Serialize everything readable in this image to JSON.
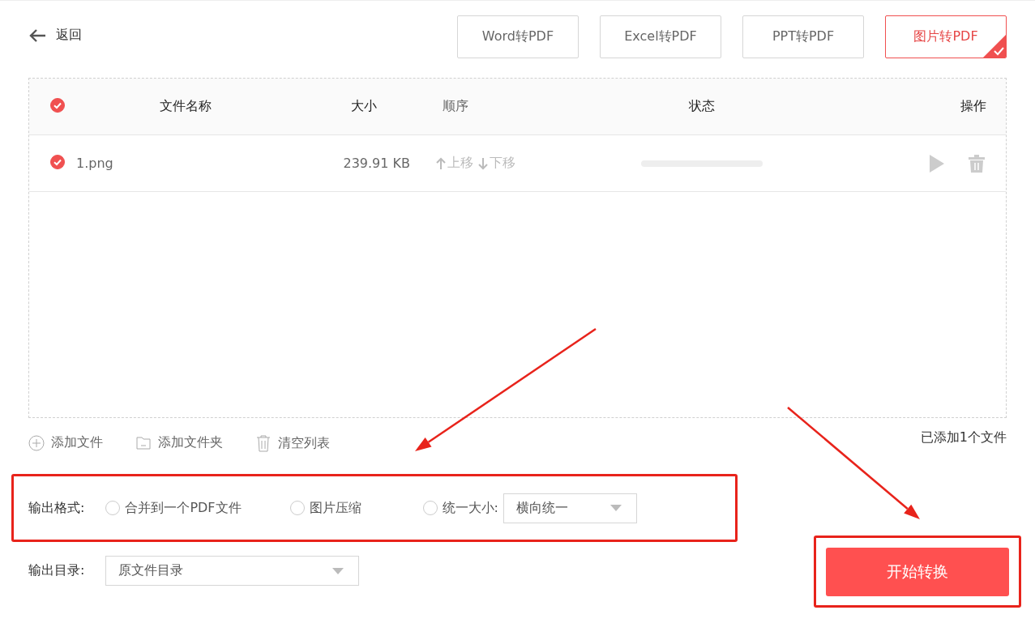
{
  "back": {
    "label": "返回"
  },
  "tabs": [
    {
      "label": "Word转PDF",
      "selected": false
    },
    {
      "label": "Excel转PDF",
      "selected": false
    },
    {
      "label": "PPT转PDF",
      "selected": false
    },
    {
      "label": "图片转PDF",
      "selected": true
    }
  ],
  "table": {
    "header_checked": true,
    "columns": [
      "文件名称",
      "大小",
      "顺序",
      "状态",
      "操作"
    ],
    "rows": [
      {
        "checked": true,
        "name": "1.png",
        "size": "239.91 KB",
        "move_up": "上移",
        "move_down": "下移",
        "level": 0
      }
    ]
  },
  "toolbar": {
    "actions": [
      {
        "kind": "add",
        "label": "添加文件"
      },
      {
        "kind": "folder",
        "label": "添加文件夹"
      },
      {
        "kind": "clear",
        "label": "清空列表"
      }
    ],
    "count": "已添加1个文件"
  },
  "output_format": {
    "label": "输出格式:",
    "options": [
      {
        "label": "合并到一个PDF文件",
        "selected": false
      },
      {
        "label": "图片压缩",
        "selected": false
      },
      {
        "label": "统一大小:",
        "selected": false
      }
    ],
    "size_select": "横向统一"
  },
  "output_dir": {
    "label": "输出目录:",
    "value": "原文件目录"
  },
  "start_button": "开始转换"
}
